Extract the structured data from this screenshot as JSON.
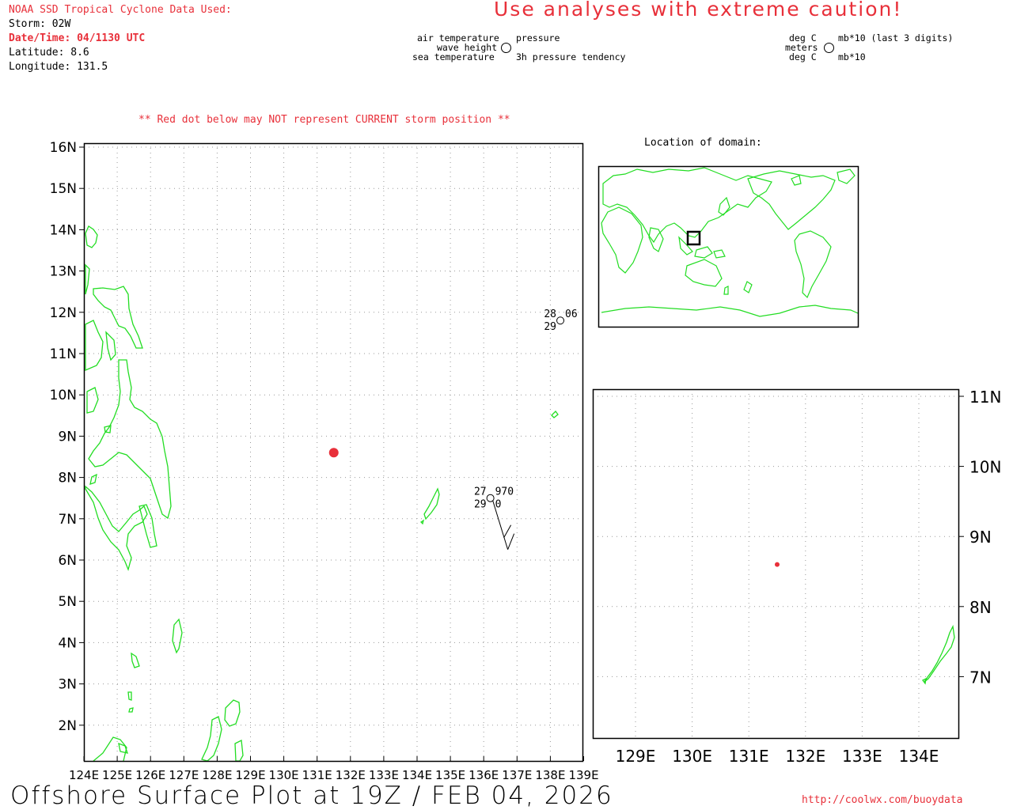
{
  "header": {
    "source_title": "NOAA SSD Tropical Cyclone Data Used:",
    "storm": "Storm: 02W",
    "datetime": "Date/Time: 04/1130 UTC",
    "latitude": "Latitude: 8.6",
    "longitude": "Longitude: 131.5",
    "caution": "Use analyses with extreme caution!"
  },
  "legend": {
    "air_temperature": "air temperature",
    "wave_height": "wave height",
    "sea_temperature": "sea temperature",
    "pressure": "pressure",
    "pressure_tendency": "3h pressure tendency",
    "unit_deg_c_top": "deg C",
    "unit_meters": "meters",
    "unit_deg_c_bottom": "deg C",
    "unit_mb_top": "mb*10 (last 3 digits)",
    "unit_mb_bottom": "mb*10"
  },
  "notice": "** Red dot below may NOT represent CURRENT storm position **",
  "location_label": "Location of domain:",
  "footer": {
    "title": "Offshore Surface Plot at 19Z / FEB 04, 2026",
    "url": "http://coolwx.com/buoydata"
  },
  "colors": {
    "coast": "#22dd22",
    "storm": "#e8303a",
    "grid": "#999999",
    "text_red": "#e8303a"
  },
  "main_map": {
    "lon_ticks": [
      "124E",
      "125E",
      "126E",
      "127E",
      "128E",
      "129E",
      "130E",
      "131E",
      "132E",
      "133E",
      "134E",
      "135E",
      "136E",
      "137E",
      "138E",
      "139E"
    ],
    "lat_ticks": [
      "16N",
      "15N",
      "14N",
      "13N",
      "12N",
      "11N",
      "10N",
      "9N",
      "8N",
      "7N",
      "6N",
      "5N",
      "4N",
      "3N",
      "2N"
    ],
    "storm": {
      "lon": 131.5,
      "lat": 8.6
    },
    "stations": [
      {
        "id": "station-a",
        "lon": 136.2,
        "lat": 7.5,
        "air_temp": "27",
        "sea_temp": "29",
        "pressure": "970",
        "tendency": "0"
      },
      {
        "id": "station-b",
        "lon": 138.3,
        "lat": 11.8,
        "air_temp": "28",
        "sea_temp": "29",
        "pressure": "06",
        "tendency": ""
      }
    ]
  },
  "inset_map": {
    "lon_ticks": [
      "129E",
      "130E",
      "131E",
      "132E",
      "133E",
      "134E"
    ],
    "lat_ticks": [
      "11N",
      "10N",
      "9N",
      "8N",
      "7N"
    ]
  }
}
